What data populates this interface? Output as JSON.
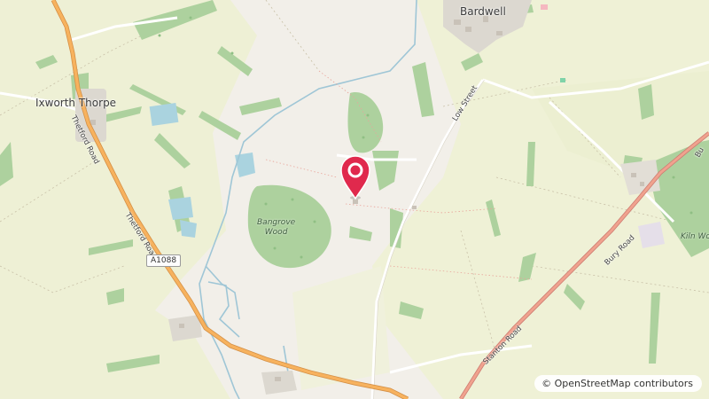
{
  "map": {
    "places": {
      "bardwell": "Bardwell",
      "ixworth_thorpe": "Ixworth Thorpe"
    },
    "woods": {
      "bangrove_wood": "Bangrove\nWood",
      "kiln_wood": "Kiln Wo"
    },
    "roads": {
      "low_street": "Low Street",
      "thetford_road_upper": "Thetford Road",
      "thetford_road_lower": "Thetford Road",
      "stanton_road": "Stanton Road",
      "bury_road": "Bury Road",
      "bury_road_edge": "Bu",
      "a1088": "A1088"
    },
    "marker_icon": "location-pin-icon",
    "colors": {
      "land": "#f2efe9",
      "farmland": "#eef0d5",
      "wood": "#add19e",
      "water": "#aad3df",
      "major_road": "#f7b25e",
      "major_road_casing": "#d49046",
      "marker": "#e0294d"
    }
  },
  "attribution": {
    "icon": "copyright-icon",
    "text": "© OpenStreetMap contributors"
  }
}
